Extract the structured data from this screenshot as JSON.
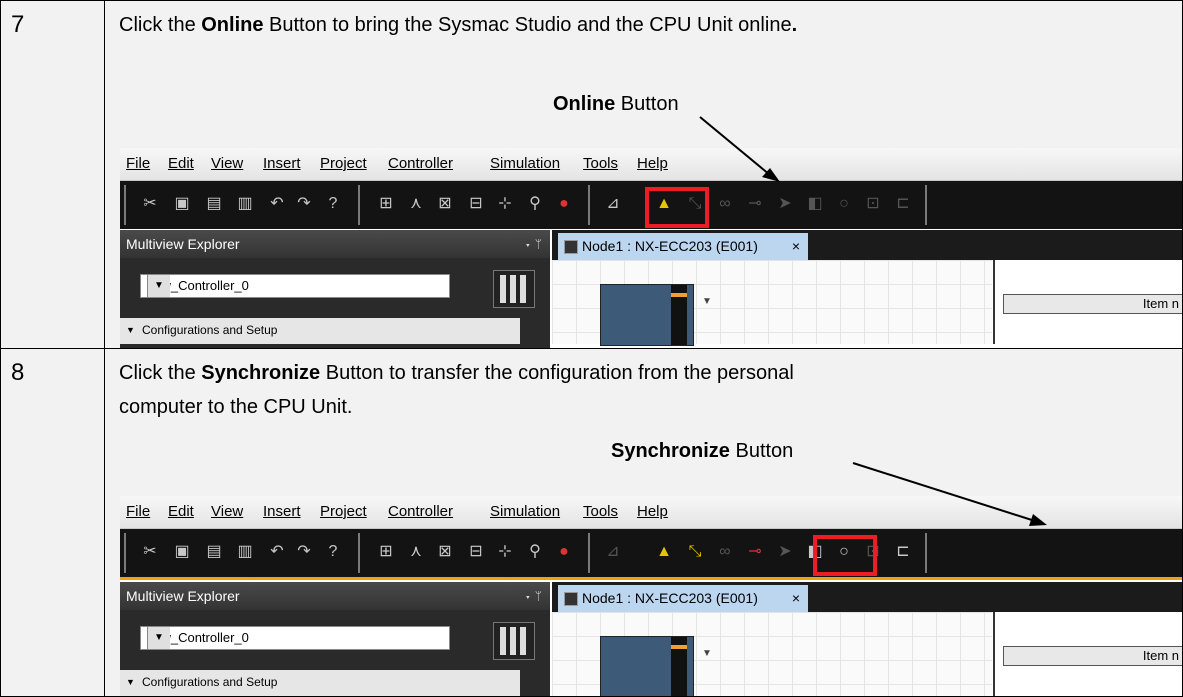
{
  "steps": [
    {
      "number": "7",
      "instruction": {
        "pre": "Click the ",
        "bold": "Online",
        "post": " Button to bring the Sysmac Studio and the CPU Unit online",
        "post_bold": "."
      },
      "callout": {
        "bold": "Online",
        "rest": " Button"
      }
    },
    {
      "number": "8",
      "instruction": {
        "pre": "Click the ",
        "bold": "Synchronize",
        "post": " Button to transfer the configuration from the personal",
        "line2": "computer to the CPU Unit."
      },
      "callout": {
        "bold": "Synchronize",
        "rest": " Button"
      }
    }
  ],
  "app": {
    "menu": [
      "File",
      "Edit",
      "View",
      "Insert",
      "Project",
      "Controller",
      "Simulation",
      "Tools",
      "Help"
    ],
    "toolbar_icons": [
      "cut-icon",
      "copy-icon",
      "paste-icon",
      "delete-icon",
      "undo-icon",
      "redo-icon",
      "help-icon",
      "window-icon",
      "build-icon",
      "compare-icon",
      "ladder-icon",
      "cross-ref-icon",
      "search-icon",
      "error-icon",
      "monitor-icon",
      "online-icon",
      "offline-icon",
      "watch-icon",
      "set-icon",
      "transfer-to-icon",
      "transfer-from-icon",
      "synchronize-icon",
      "ecat-icon",
      "network-icon"
    ],
    "explorer_title": "Multiview Explorer",
    "explorer_pin": "▾ ᛘ",
    "controller_select": "new_Controller_0",
    "config_node": "Configurations and Setup",
    "tab_label": "Node1 : NX-ECC203 (E001)",
    "tab_close": "×",
    "props_header": "Item n"
  },
  "colors": {
    "highlight": "#ee1c25",
    "toolbar": "#131313",
    "tab": "#bcd6f0",
    "status_line": "#f0a30a"
  }
}
